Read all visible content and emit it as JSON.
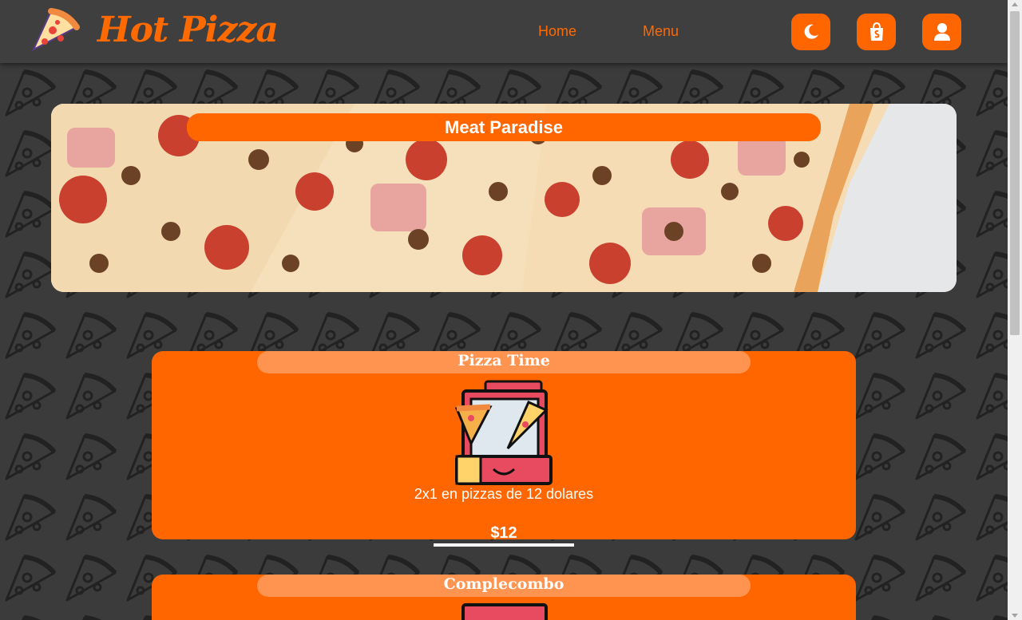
{
  "brand": {
    "name": "Hot Pizza",
    "logo_icon": "pizza-slice-icon"
  },
  "nav": {
    "links": [
      {
        "label": "Home"
      },
      {
        "label": "Menu"
      }
    ],
    "buttons": [
      {
        "icon": "moon-icon"
      },
      {
        "icon": "shopping-bag-icon"
      },
      {
        "icon": "user-icon"
      }
    ]
  },
  "hero": {
    "title": "Meat Paradise"
  },
  "cards": [
    {
      "title": "Pizza Time",
      "description": "2x1 en pizzas de 12 dolares",
      "price": "$12",
      "image_icon": "pizza-box-icon"
    },
    {
      "title": "Complecombo",
      "image_icon": "pizza-box-icon"
    }
  ],
  "colors": {
    "accent": "#ff6600",
    "navbar": "#3f3f3f",
    "background": "#3b3b3b",
    "title_pill": "#ff9450"
  }
}
